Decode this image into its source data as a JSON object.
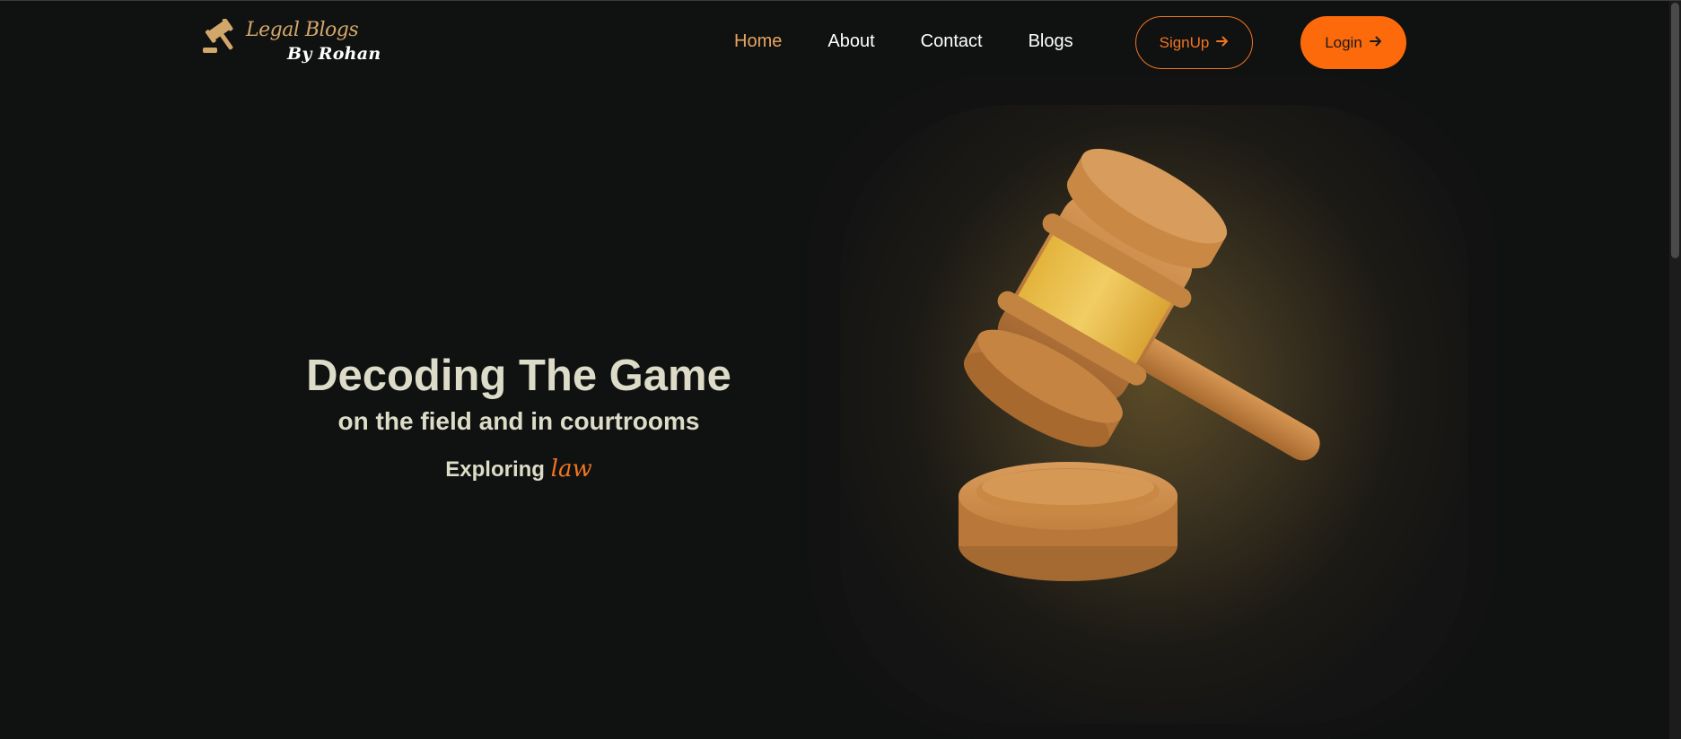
{
  "logo": {
    "line1": "Legal Blogs",
    "line2": "By Rohan",
    "icon": "gavel-icon"
  },
  "nav": {
    "items": [
      {
        "label": "Home",
        "active": true
      },
      {
        "label": "About",
        "active": false
      },
      {
        "label": "Contact",
        "active": false
      },
      {
        "label": "Blogs",
        "active": false
      }
    ]
  },
  "buttons": {
    "signup_label": "SignUp",
    "login_label": "Login"
  },
  "hero": {
    "title": "Decoding The Game",
    "subtitle": "on the field and in courtrooms",
    "tagline_prefix": "Exploring",
    "tagline_accent": "law",
    "image_icon": "gavel-icon"
  },
  "colors": {
    "accent": "#fd6a0b",
    "nav_active": "#e8a55f",
    "logo_gold": "#d2a86a",
    "background": "#101111",
    "hero_text": "#dcdcc8"
  }
}
